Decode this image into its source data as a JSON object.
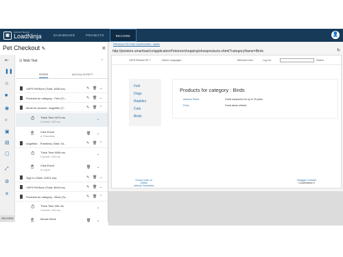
{
  "app": {
    "brand_small": "SMARTBEAR",
    "brand": "LoadNinja",
    "user_initial": "👤"
  },
  "nav": [
    "DASHBOARD",
    "PROJECTS",
    "RECORD"
  ],
  "page_title": "Pet Checkout",
  "panel": {
    "group_title": "Web Test",
    "tabs": [
      "STEPS",
      "MOCHA SCRIPT"
    ],
    "rows": [
      {
        "label": "YAPS PetStore (Total: 1835 ms)"
      },
      {
        "label": "Products for category : Fish (To..."
      },
      {
        "label": "Items for product : Angelfish (T..."
      },
      {
        "label": "Angelfish - Threeless (Total: 16..."
      },
      {
        "label": "Sign In (Total: 12921 ms)"
      },
      {
        "label": "YAPS PetStore (Total: 3643 ms)"
      },
      {
        "label": "Products for category : Birds (To..."
      }
    ],
    "subs": [
      {
        "l1": "Think Time 1673 ms",
        "l2": "Current: 100 ms"
      },
      {
        "l1": "Click Event",
        "l2": "a Threeless"
      },
      {
        "l1": "Think Time 5096 ms",
        "l2": "Current: 100 ms"
      },
      {
        "l1": "Click Event",
        "l2": "a Log in"
      },
      {
        "l1": "Think Time 300 ms",
        "l2": "Current: 100 ms"
      },
      {
        "l1": "Mouse Move",
        "l2": ""
      }
    ],
    "record_label": "RECORD"
  },
  "browser": {
    "tab": "PRODUCTS FOR CATEGORY : BIRD",
    "url": "http://petstore.smartload.io/applicationPetstore/shopping/showproducts.xhtml?categoryName=Birds",
    "header_left": "YAPS Petstore EE 7",
    "header_menu": "Admin    Languages",
    "header_welcome": "Welcome User",
    "header_login": "Log out",
    "search_label": "Search",
    "categories": [
      "Fish",
      "Dogs",
      "Reptiles",
      "Cats",
      "Birds"
    ],
    "products_title": "Products for category : Birds",
    "products": [
      {
        "name": "Amazon Parrot",
        "desc": "Great companion for up to 75 years"
      },
      {
        "name": "Finch",
        "desc": "Great stress reliever"
      }
    ],
    "footer_left": [
      "Source code on",
      "GitHub",
      "Antonio Goncalves"
    ],
    "footer_right": [
      "Swagger Contract",
      "Conversation 0"
    ]
  },
  "colors": {
    "nav_bg": "#163a58",
    "accent": "#2a6fa8"
  }
}
